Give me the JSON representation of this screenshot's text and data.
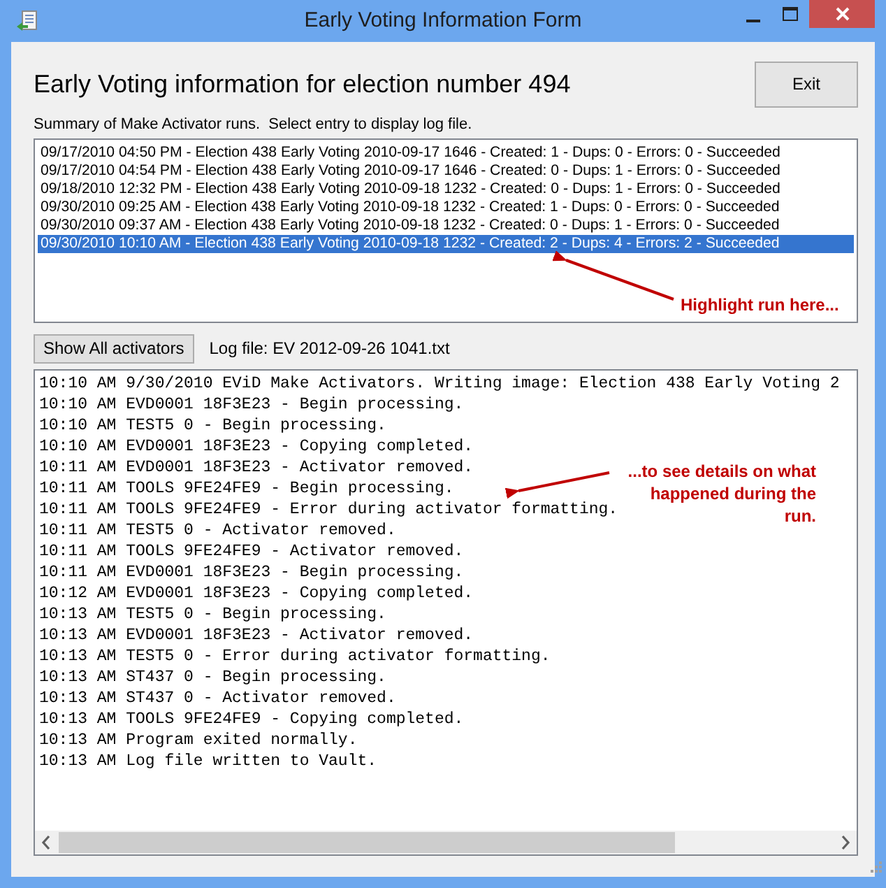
{
  "window": {
    "title": "Early Voting Information Form"
  },
  "heading": "Early Voting information for election number 494",
  "exit_button": "Exit",
  "summary_label": "Summary of Make Activator runs.  Select entry to display log file.",
  "runs": [
    {
      "text": "09/17/2010 04:50 PM - Election 438 Early Voting 2010-09-17 1646 - Created: 1 - Dups: 0 - Errors: 0 - Succeeded",
      "selected": false
    },
    {
      "text": "09/17/2010 04:54 PM - Election 438 Early Voting 2010-09-17 1646 - Created: 0 - Dups: 1 - Errors: 0 - Succeeded",
      "selected": false
    },
    {
      "text": "09/18/2010 12:32 PM - Election 438 Early Voting 2010-09-18 1232 - Created: 0 - Dups: 1 - Errors: 0 - Succeeded",
      "selected": false
    },
    {
      "text": "09/30/2010 09:25 AM - Election 438 Early Voting 2010-09-18 1232 - Created: 1 - Dups: 0 - Errors: 0 - Succeeded",
      "selected": false
    },
    {
      "text": "09/30/2010 09:37 AM - Election 438 Early Voting 2010-09-18 1232 - Created: 0 - Dups: 1 - Errors: 0 - Succeeded",
      "selected": false
    },
    {
      "text": "09/30/2010 10:10 AM - Election 438 Early Voting 2010-09-18 1232 - Created: 2 - Dups: 4 - Errors: 2 - Succeeded",
      "selected": true
    }
  ],
  "show_all_button": "Show All activators",
  "log_file_label": "Log file: EV 2012-09-26 1041.txt",
  "log_lines": [
    "10:10 AM 9/30/2010 EViD Make Activators. Writing image: Election 438 Early Voting 2",
    "10:10 AM EVD0001 18F3E23 - Begin processing.",
    "10:10 AM TEST5 0 - Begin processing.",
    "10:10 AM EVD0001 18F3E23 - Copying completed.",
    "10:11 AM EVD0001 18F3E23 - Activator removed.",
    "10:11 AM TOOLS 9FE24FE9 - Begin processing.",
    "10:11 AM TOOLS 9FE24FE9 - Error during activator formatting.",
    "10:11 AM TEST5 0 - Activator removed.",
    "10:11 AM TOOLS 9FE24FE9 - Activator removed.",
    "10:11 AM EVD0001 18F3E23 - Begin processing.",
    "10:12 AM EVD0001 18F3E23 - Copying completed.",
    "10:13 AM TEST5 0 - Begin processing.",
    "10:13 AM EVD0001 18F3E23 - Activator removed.",
    "10:13 AM TEST5 0 - Error during activator formatting.",
    "10:13 AM ST437 0 - Begin processing.",
    "10:13 AM ST437 0 - Activator removed.",
    "10:13 AM TOOLS 9FE24FE9 - Copying completed.",
    "10:13 AM Program exited normally.",
    "10:13 AM Log file written to Vault."
  ],
  "annotations": [
    {
      "text": "Highlight run here..."
    },
    {
      "text": "...to see details on what happened during the run."
    }
  ]
}
